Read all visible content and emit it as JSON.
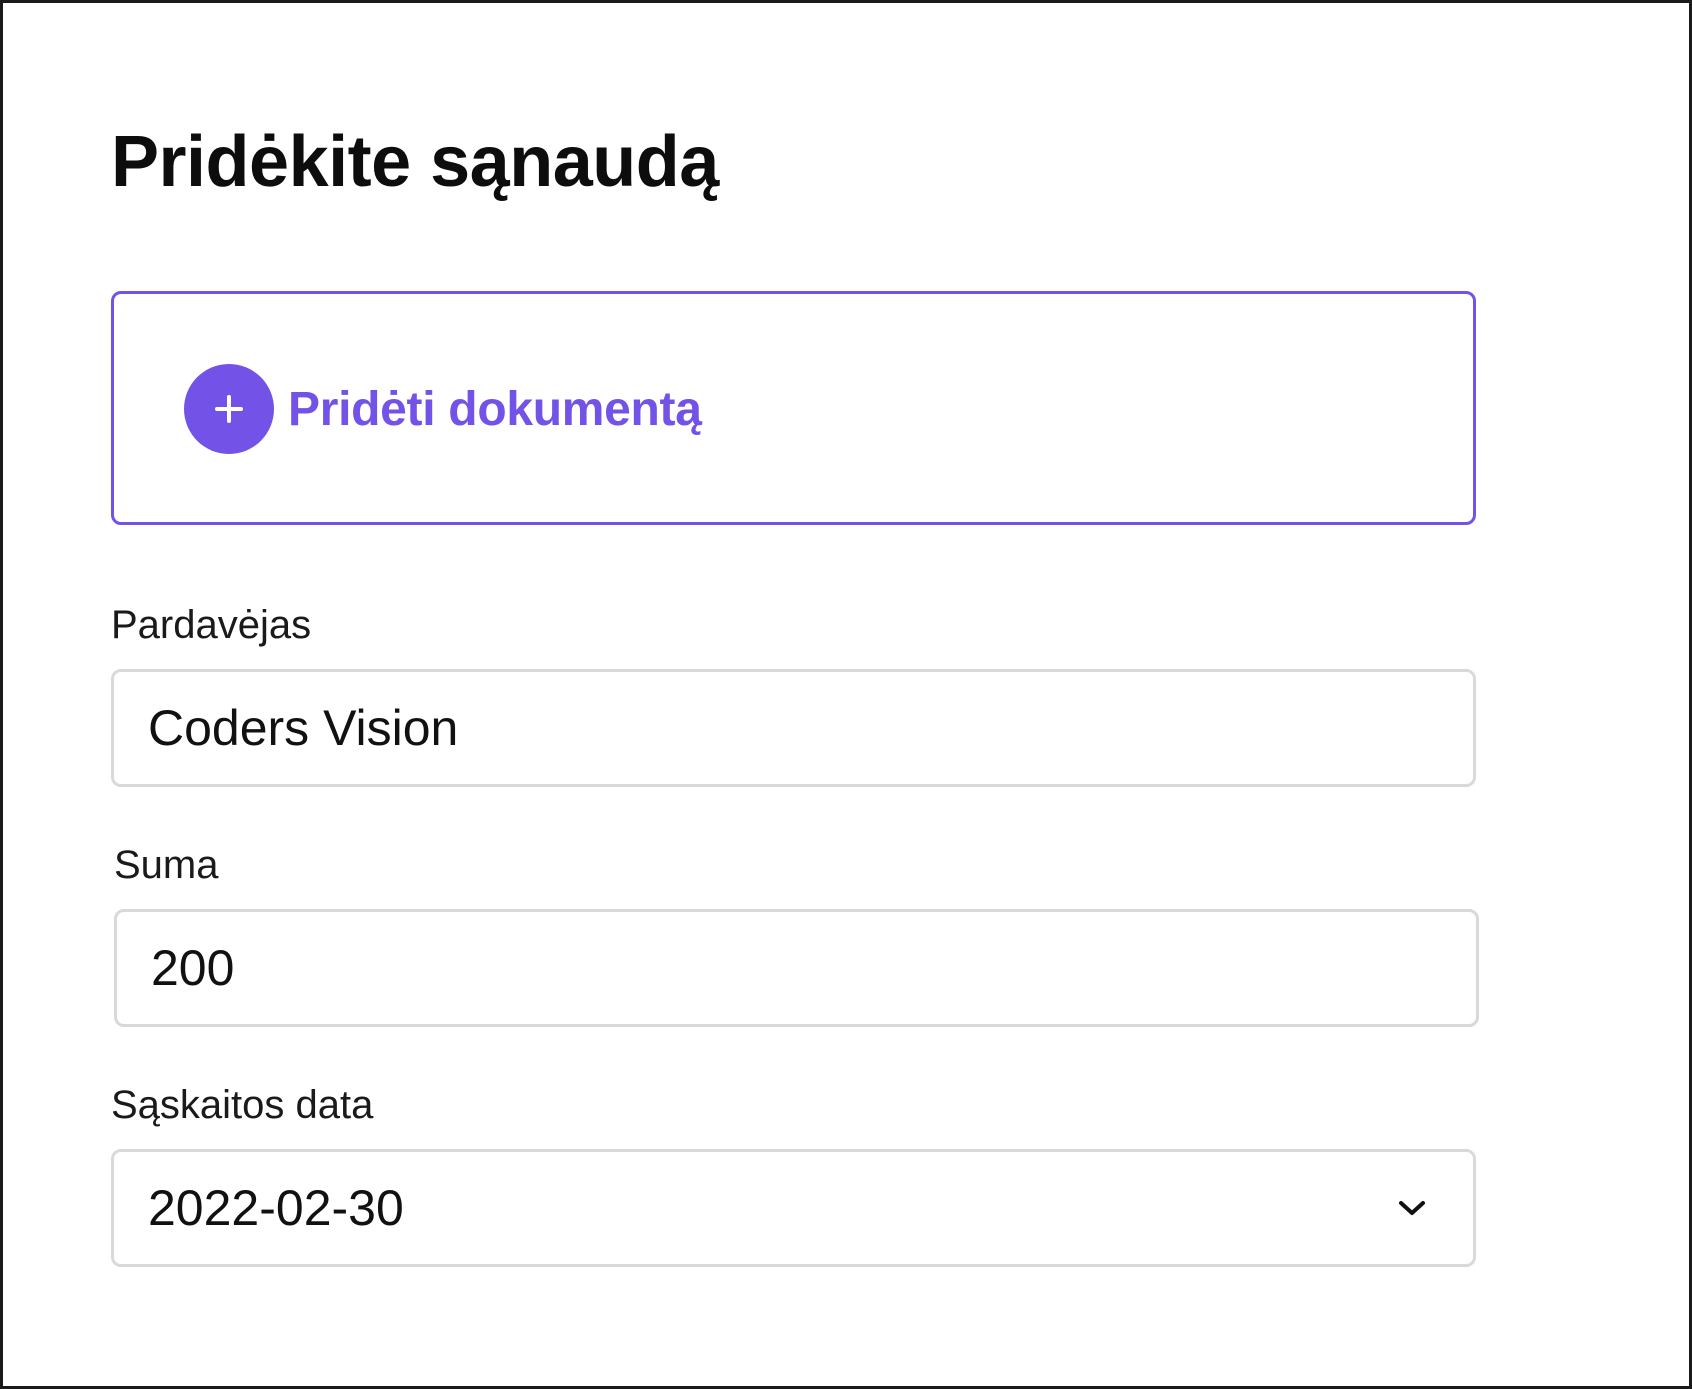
{
  "page": {
    "title": "Pridėkite sąnaudą"
  },
  "upload": {
    "add_document_label": "Pridėti dokumentą",
    "icon": "plus-icon",
    "accent_color": "#7352e8"
  },
  "fields": {
    "seller": {
      "label": "Pardavėjas",
      "value": "Coders Vision"
    },
    "amount": {
      "label": "Suma",
      "value": "200"
    },
    "invoice_date": {
      "label": "Sąskaitos data",
      "value": "2022-02-30",
      "icon": "chevron-down-icon"
    }
  }
}
